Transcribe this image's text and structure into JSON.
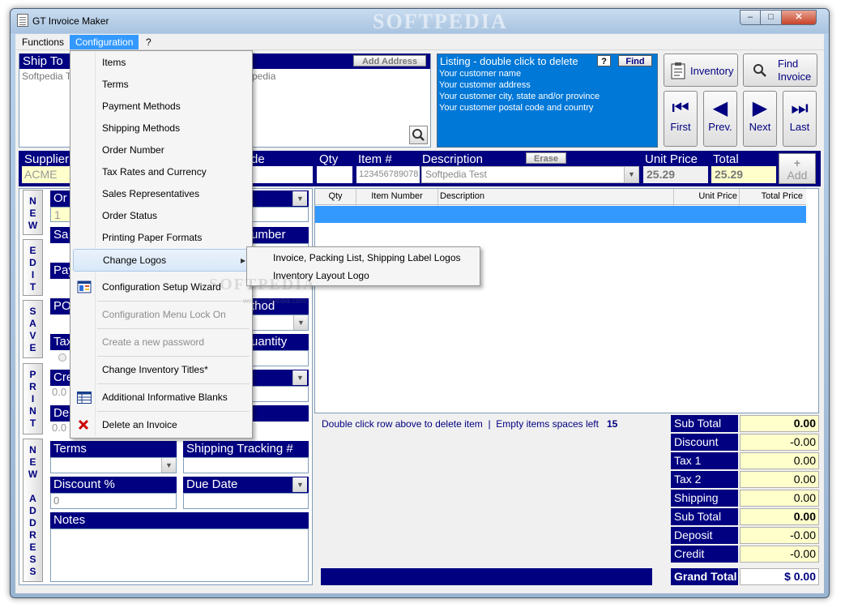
{
  "window": {
    "title": "GT Invoice Maker",
    "controls": {
      "minimize": "–",
      "maximize": "□",
      "close": "✕"
    }
  },
  "menubar": {
    "items": [
      "Functions",
      "Configuration",
      "?"
    ]
  },
  "ship_to": {
    "label": "Ship To",
    "value": "Softpedia T"
  },
  "bill_to": {
    "label_fragment": "To",
    "add_address_label": "Add Address",
    "value_fragment": "pedia"
  },
  "listing": {
    "title": "Listing - double click to delete",
    "help_label": "?",
    "find_label": "Find",
    "lines": [
      "Your customer name",
      "Your customer address",
      "Your customer city, state and/or province",
      "Your customer postal code and country"
    ]
  },
  "nav": {
    "inventory": "Inventory",
    "find_invoice_line1": "Find",
    "find_invoice_line2": "Invoice",
    "first": "First",
    "prev": "Prev.",
    "next": "Next",
    "last": "Last"
  },
  "entry": {
    "supplier_label": "Supplier",
    "supplier_value": "ACME",
    "code_fragment": "de",
    "qty_label": "Qty",
    "item_label": "Item #",
    "item_value": "123456789078",
    "description_label": "Description",
    "erase_label": "Erase",
    "description_value": "Softpedia Test",
    "unit_price_label": "Unit Price",
    "unit_price_value": "25.29",
    "total_label": "Total",
    "total_value": "25.29",
    "add_icon": "+",
    "add_label": "Add"
  },
  "side_buttons": [
    [
      "N",
      "E",
      "W"
    ],
    [
      "E",
      "D",
      "I",
      "T"
    ],
    [
      "S",
      "A",
      "V",
      "E"
    ],
    [
      "P",
      "R",
      "I",
      "N",
      "T"
    ],
    [
      "N",
      "E",
      "W",
      "",
      "A",
      "D",
      "D",
      "R",
      "E",
      "S",
      "S"
    ]
  ],
  "left_form": {
    "order_fragment": "Or",
    "order_value": "1",
    "sa_fragment": "Sa",
    "pay_fragment": "Pay",
    "po_fragment": "PO",
    "tax_fragment": "Tax",
    "cre_fragment": "Cre",
    "cre_value": "0.0",
    "de_fragment": "De",
    "de_value": "0.0",
    "number_fragment": "umber",
    "method_fragment": "thod",
    "quantity_fragment": "uantity",
    "terms_label": "Terms",
    "tracking_label": "Shipping Tracking  #",
    "discount_label": "Discount %",
    "discount_value": "0",
    "due_date_label": "Due Date",
    "notes_label": "Notes"
  },
  "grid": {
    "columns": [
      "Qty",
      "Item Number",
      "Description",
      "Unit Price",
      "Total Price"
    ]
  },
  "status": {
    "message": "Double click row above to delete item",
    "separator": "|",
    "empty_label": "Empty items spaces left",
    "empty_count": "15"
  },
  "totals": [
    {
      "label": "Sub Total",
      "value": "0.00",
      "bold": true
    },
    {
      "label": "Discount",
      "value": "-0.00"
    },
    {
      "label": "Tax 1",
      "value": "0.00"
    },
    {
      "label": "Tax 2",
      "value": "0.00"
    },
    {
      "label": "Shipping",
      "value": "0.00"
    },
    {
      "label": "Sub Total",
      "value": "0.00",
      "bold": true
    },
    {
      "label": "Deposit",
      "value": "-0.00"
    },
    {
      "label": "Credit",
      "value": "-0.00"
    }
  ],
  "grand_total": {
    "label": "Grand Total",
    "value": "$ 0.00"
  },
  "config_menu": {
    "items": [
      "Items",
      "Terms",
      "Payment Methods",
      "Shipping Methods",
      "Order Number",
      "Tax Rates and Currency",
      "Sales Representatives",
      "Order Status",
      "Printing Paper Formats",
      "Change Logos",
      "Configuration Setup Wizard",
      "Configuration Menu Lock On",
      "Create a new password",
      "Change Inventory Titles*",
      "Additional Informative Blanks",
      "Delete an Invoice"
    ],
    "submenu_arrow": "▶"
  },
  "logos_submenu": {
    "items": [
      "Invoice, Packing List, Shipping Label Logos",
      "Inventory Layout Logo"
    ]
  },
  "watermark": {
    "text": "SOFTPEDIA",
    "url": "www.softpedia.com"
  },
  "colors": {
    "navy": "#000080",
    "listing_bg": "#0078d7",
    "selection_blue": "#3399ff",
    "yellow_field": "#ffffcc",
    "delete_red": "#cc0000"
  },
  "icons": [
    "app-icon",
    "clipboard-icon",
    "magnifier-icon",
    "search-icon",
    "first-icon",
    "prev-icon",
    "next-icon",
    "last-icon",
    "wizard-icon",
    "table-icon",
    "delete-x-icon",
    "submenu-arrow-icon",
    "combo-arrow-icon"
  ]
}
